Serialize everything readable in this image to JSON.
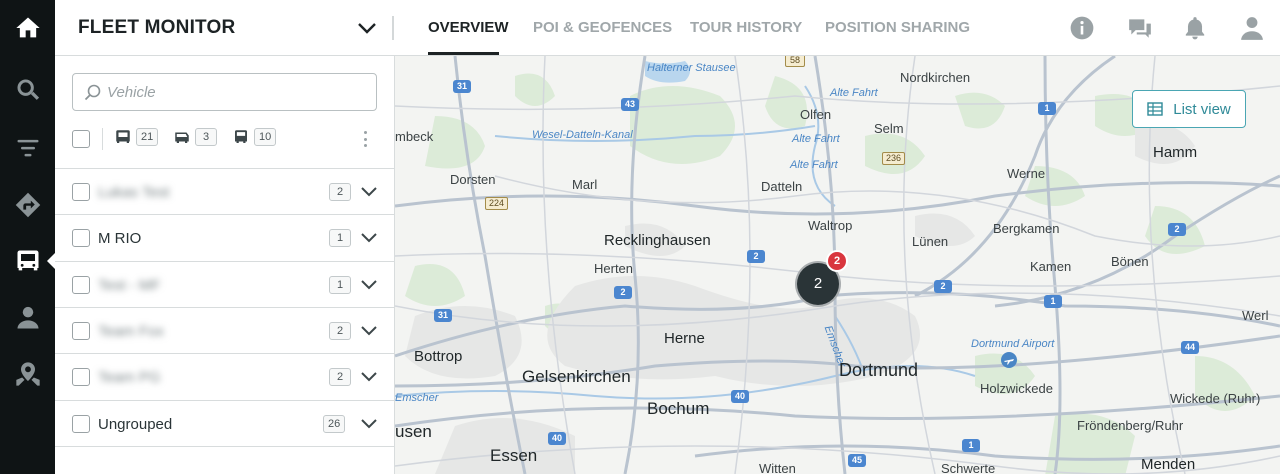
{
  "header": {
    "app_title": "FLEET MONITOR",
    "tabs": [
      {
        "label": "OVERVIEW",
        "active": true
      },
      {
        "label": "POI & GEOFENCES",
        "active": false
      },
      {
        "label": "TOUR HISTORY",
        "active": false
      },
      {
        "label": "POSITION SHARING",
        "active": false
      }
    ],
    "icons": [
      "info-icon",
      "chat-icon",
      "bell-icon",
      "user-icon"
    ]
  },
  "rail": {
    "items": [
      "home-icon",
      "search-icon",
      "filter-icon",
      "route-icon",
      "bus-icon",
      "driver-icon",
      "map-pin-icon"
    ],
    "active": "bus-icon"
  },
  "sidebar": {
    "search_placeholder": "Vehicle",
    "vehicle_type_counts": [
      {
        "icon": "bus-icon",
        "count": "21"
      },
      {
        "icon": "van-icon",
        "count": "3"
      },
      {
        "icon": "truck-icon",
        "count": "10"
      }
    ],
    "groups": [
      {
        "name": "Lukas Test",
        "count": "2",
        "blurred": true
      },
      {
        "name": "M RIO",
        "count": "1",
        "blurred": false
      },
      {
        "name": "Test - MF",
        "count": "1",
        "blurred": true
      },
      {
        "name": "Team Fox",
        "count": "2",
        "blurred": true
      },
      {
        "name": "Team PG",
        "count": "2",
        "blurred": true
      },
      {
        "name": "Ungrouped",
        "count": "26",
        "blurred": false
      }
    ]
  },
  "map": {
    "list_view_label": "List view",
    "cluster_count": "2",
    "cluster_alert_count": "2",
    "places": {
      "halterner_stausee": "Halterner Stausee",
      "nordkirchen": "Nordkirchen",
      "alte_fahrt_1": "Alte Fahrt",
      "olfen": "Olfen",
      "selm": "Selm",
      "alte_fahrt_2": "Alte Fahrt",
      "alte_fahrt_3": "Alte Fahrt",
      "hamm": "Hamm",
      "mbeck": "mbeck",
      "wesel_datteln": "Wesel-Datteln-Kanal",
      "dorsten": "Dorsten",
      "marl": "Marl",
      "datteln": "Datteln",
      "werne": "Werne",
      "waltrop": "Waltrop",
      "bergkamen": "Bergkamen",
      "recklinghausen": "Recklinghausen",
      "luenen": "Lünen",
      "herten": "Herten",
      "kamen": "Kamen",
      "boenen": "Bönen",
      "emscher": "Emscher",
      "werl": "Werl",
      "herne": "Herne",
      "dortmund_airport": "Dortmund Airport",
      "bottrop": "Bottrop",
      "gelsenkirchen": "Gelsenkirchen",
      "dortmund": "Dortmund",
      "holzwickede": "Holzwickede",
      "emscher_2": "Emscher",
      "bochum": "Bochum",
      "wickede": "Wickede (Ruhr)",
      "usen": "usen",
      "froendenberg": "Fröndenberg/Ruhr",
      "essen": "Essen",
      "witten": "Witten",
      "schwerte": "Schwerte",
      "menden": "Menden"
    },
    "shields": {
      "a31_top": "31",
      "a43": "43",
      "a1_top": "1",
      "a2_east": "2",
      "a2_mid": "2",
      "a2_west": "2",
      "a2_kamen": "2",
      "a1_mid": "1",
      "a31_bottom": "31",
      "a44": "44",
      "a40_mid": "40",
      "a40_left": "40",
      "a1_bottom": "1",
      "a45": "45",
      "a2_center": "2"
    },
    "road_numbers": {
      "b58": "58",
      "b224": "224",
      "b236": "236"
    }
  },
  "colors": {
    "rail_bg": "#0f1415",
    "accent_teal": "#2f8a98",
    "cluster": "#2a3437",
    "alert_red": "#d9363e",
    "motorway_blue": "#4b86cf"
  }
}
